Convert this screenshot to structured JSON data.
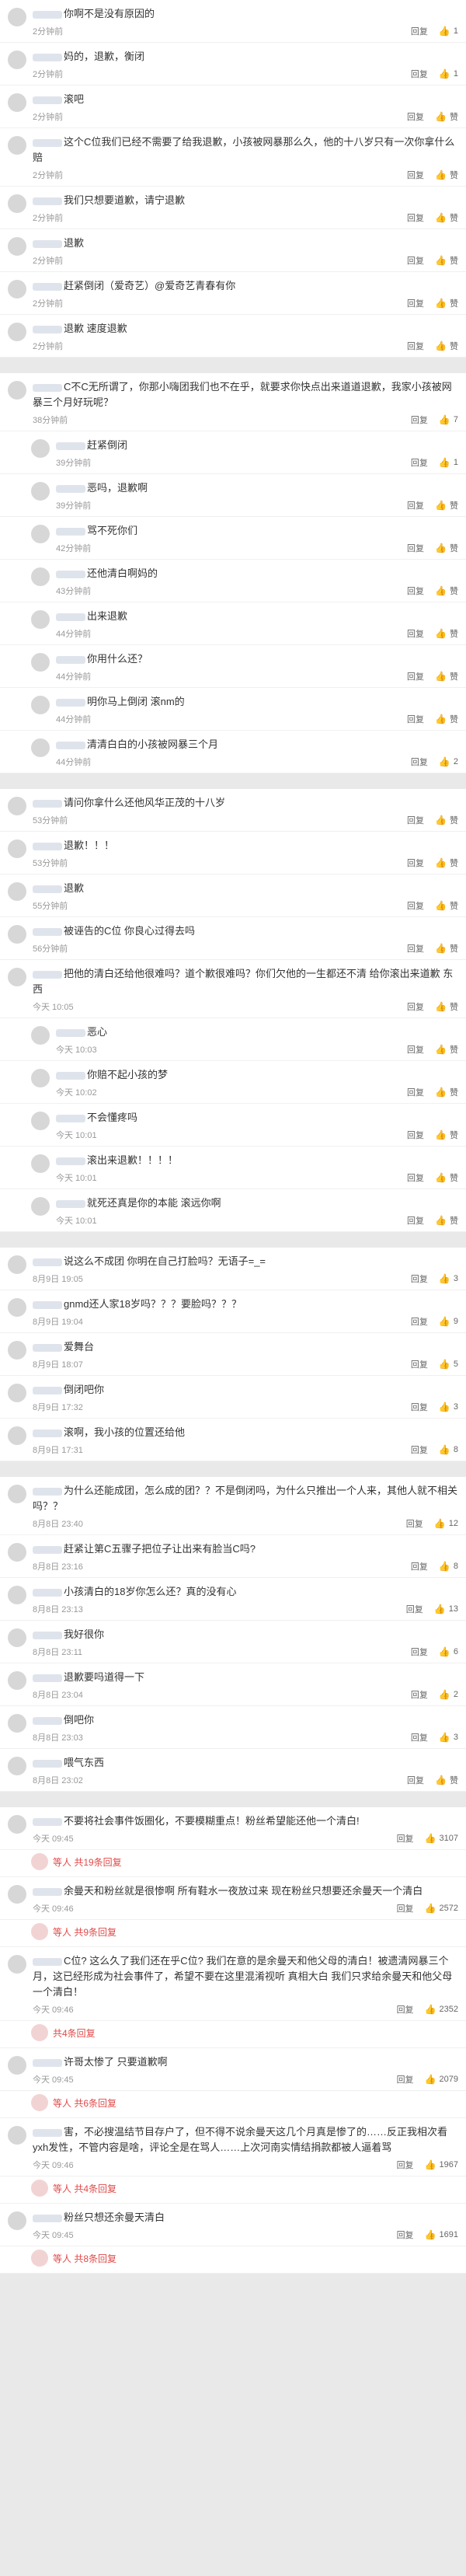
{
  "ui": {
    "reply": "回复",
    "like": "赞"
  },
  "sections": [
    {
      "comments": [
        {
          "text": "你啊不是没有原因的",
          "time": "2分钟前",
          "likes": "1"
        },
        {
          "text": "妈的，退歉，衡闭",
          "time": "2分钟前",
          "likes": "1"
        },
        {
          "text": "滚吧",
          "time": "2分钟前",
          "likes": ""
        },
        {
          "text": "这个C位我们已经不需要了给我退歉，小孩被网暴那么久，他的十八岁只有一次你拿什么赔",
          "time": "2分钟前",
          "likes": ""
        },
        {
          "text": "我们只想要道歉，请宁退歉",
          "time": "2分钟前",
          "likes": ""
        },
        {
          "text": "退歉",
          "time": "2分钟前",
          "likes": ""
        },
        {
          "text": "赶紧倒闭（爱奇艺）@爱奇艺青春有你",
          "time": "2分钟前",
          "likes": ""
        },
        {
          "text": "退歉 速度退歉",
          "time": "2分钟前",
          "likes": ""
        }
      ]
    },
    {
      "comments": [
        {
          "text": "C不C无所谓了，你那小嗨团我们也不在乎，就要求你快点出来道道退歉，我家小孩被网暴三个月好玩呢？",
          "time": "38分钟前",
          "likes": "7"
        },
        {
          "text": "赶紧倒闭",
          "time": "39分钟前",
          "likes": "1",
          "sub": true
        },
        {
          "text": "恶吗，退歉啊",
          "time": "39分钟前",
          "likes": "",
          "sub": true
        },
        {
          "text": "骂不死你们",
          "time": "42分钟前",
          "likes": "",
          "sub": true
        },
        {
          "text": "还他清白啊妈的",
          "time": "43分钟前",
          "likes": "",
          "sub": true
        },
        {
          "text": "出来退歉",
          "time": "44分钟前",
          "likes": "",
          "sub": true
        },
        {
          "text": "你用什么还？",
          "time": "44分钟前",
          "likes": "",
          "sub": true
        },
        {
          "text": "明你马上倒闭 滚nm的",
          "time": "44分钟前",
          "likes": "",
          "sub": true
        },
        {
          "text": "清清白白的小孩被网暴三个月",
          "time": "44分钟前",
          "likes": "2",
          "sub": true
        }
      ]
    },
    {
      "comments": [
        {
          "text": "请问你拿什么还他风华正茂的十八岁",
          "time": "53分钟前",
          "likes": ""
        },
        {
          "text": "退歉！！！",
          "time": "53分钟前",
          "likes": ""
        },
        {
          "text": "退歉",
          "time": "55分钟前",
          "likes": ""
        },
        {
          "text": "被诬告的C位 你良心过得去吗",
          "time": "56分钟前",
          "likes": ""
        },
        {
          "text": "把他的清白还给他很难吗？道个歉很难吗？你们欠他的一生都还不清 给你滚出来道歉 东西",
          "time": "今天 10:05",
          "likes": ""
        },
        {
          "text": "恶心",
          "time": "今天 10:03",
          "likes": "",
          "sub": true
        },
        {
          "text": "你赔不起小孩的梦",
          "time": "今天 10:02",
          "likes": "",
          "sub": true
        },
        {
          "text": "不会懂疼吗",
          "time": "今天 10:01",
          "likes": "",
          "sub": true
        },
        {
          "text": "滚出来退歉！！！！",
          "time": "今天 10:01",
          "likes": "",
          "sub": true
        },
        {
          "text": "就死还真是你的本能 滚远你啊",
          "time": "今天 10:01",
          "likes": "",
          "sub": true
        }
      ]
    },
    {
      "comments": [
        {
          "text": "说这么不成团 你明在自己打脸吗？无语子=_=",
          "time": "8月9日 19:05",
          "likes": "3"
        },
        {
          "text": "gnmd还人家18岁吗？？？要脸吗？？？",
          "time": "8月9日 19:04",
          "likes": "9"
        },
        {
          "text": "爱舞台",
          "time": "8月9日 18:07",
          "likes": "5"
        },
        {
          "text": "倒闭吧你",
          "time": "8月9日 17:32",
          "likes": "3"
        },
        {
          "text": "滚啊，我小孩的位置还给他",
          "time": "8月9日 17:31",
          "likes": "8"
        }
      ]
    },
    {
      "comments": [
        {
          "text": "为什么还能成团，怎么成的团？？不是倒闭吗，为什么只推出一个人来，其他人就不相关吗？？",
          "time": "8月8日 23:40",
          "likes": "12"
        },
        {
          "text": "赶紧让第C五骤子把位子让出来有脸当C吗?",
          "time": "8月8日 23:16",
          "likes": "8"
        },
        {
          "text": "小孩清白的18岁你怎么还？真的没有心",
          "time": "8月8日 23:13",
          "likes": "13"
        },
        {
          "text": "我好很你",
          "time": "8月8日 23:11",
          "likes": "6"
        },
        {
          "text": "退歉要吗道得一下",
          "time": "8月8日 23:04",
          "likes": "2"
        },
        {
          "text": "倒吧你",
          "time": "8月8日 23:03",
          "likes": "3"
        },
        {
          "text": "喂气东西",
          "time": "8月8日 23:02",
          "likes": ""
        }
      ]
    },
    {
      "comments": [
        {
          "text": "不要将社会事件饭圈化，不要模糊重点！粉丝希望能还他一个清白!",
          "time": "今天 09:45",
          "likes": "3107"
        },
        {
          "more": "等人 共19条回复"
        },
        {
          "text": "余曼天和粉丝就是很惨啊 所有鞋水一夜放过来 现在粉丝只想要还余曼天一个清白",
          "time": "今天 09:46",
          "likes": "2572"
        },
        {
          "more": "等人 共9条回复"
        },
        {
          "text": "C位? 这么久了我们还在乎C位? 我们在意的是余曼天和他父母的清白！被遗清网暴三个月，这已经形成为社会事件了，希望不要在这里混淆视听 真相大白 我们只求给余曼天和他父母一个清白！",
          "time": "今天 09:46",
          "likes": "2352"
        },
        {
          "more": "共4条回复"
        },
        {
          "text": "许哥太惨了 只要道歉啊",
          "time": "今天 09:45",
          "likes": "2079"
        },
        {
          "more": "等人 共6条回复"
        },
        {
          "text": "害，不必搜温结节目存户了，但不得不说余曼天这几个月真是惨了的……反正我相次看yxh发性，不管内容是啥，评论全是在骂人……上次河南实情结捐款都被人逼着骂",
          "time": "今天 09:46",
          "likes": "1967"
        },
        {
          "more": "等人 共4条回复"
        },
        {
          "text": "粉丝只想还余曼天清白",
          "time": "今天 09:45",
          "likes": "1691"
        },
        {
          "more": "等人 共8条回复"
        }
      ]
    }
  ]
}
